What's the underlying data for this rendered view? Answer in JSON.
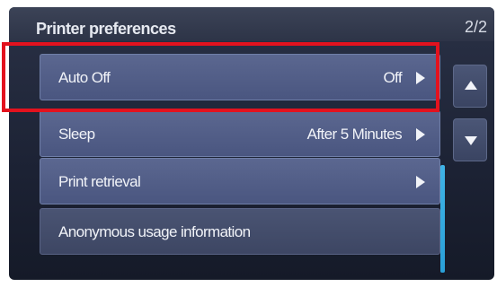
{
  "screen": {
    "title": "Printer preferences",
    "page_indicator": "2/2"
  },
  "rows": [
    {
      "label": "Auto Off",
      "value": "Off",
      "has_arrow": true
    },
    {
      "label": "Sleep",
      "value": "After 5 Minutes",
      "has_arrow": true
    },
    {
      "label": "Print retrieval",
      "value": "",
      "has_arrow": true
    },
    {
      "label": "Anonymous usage information",
      "value": "",
      "has_arrow": false
    }
  ],
  "scroll": {
    "up_icon": "triangle-up-icon",
    "down_icon": "triangle-down-icon"
  },
  "colors": {
    "highlight": "#e3121e",
    "row_bg": "#55618a",
    "scrollbar": "#33aadf"
  }
}
